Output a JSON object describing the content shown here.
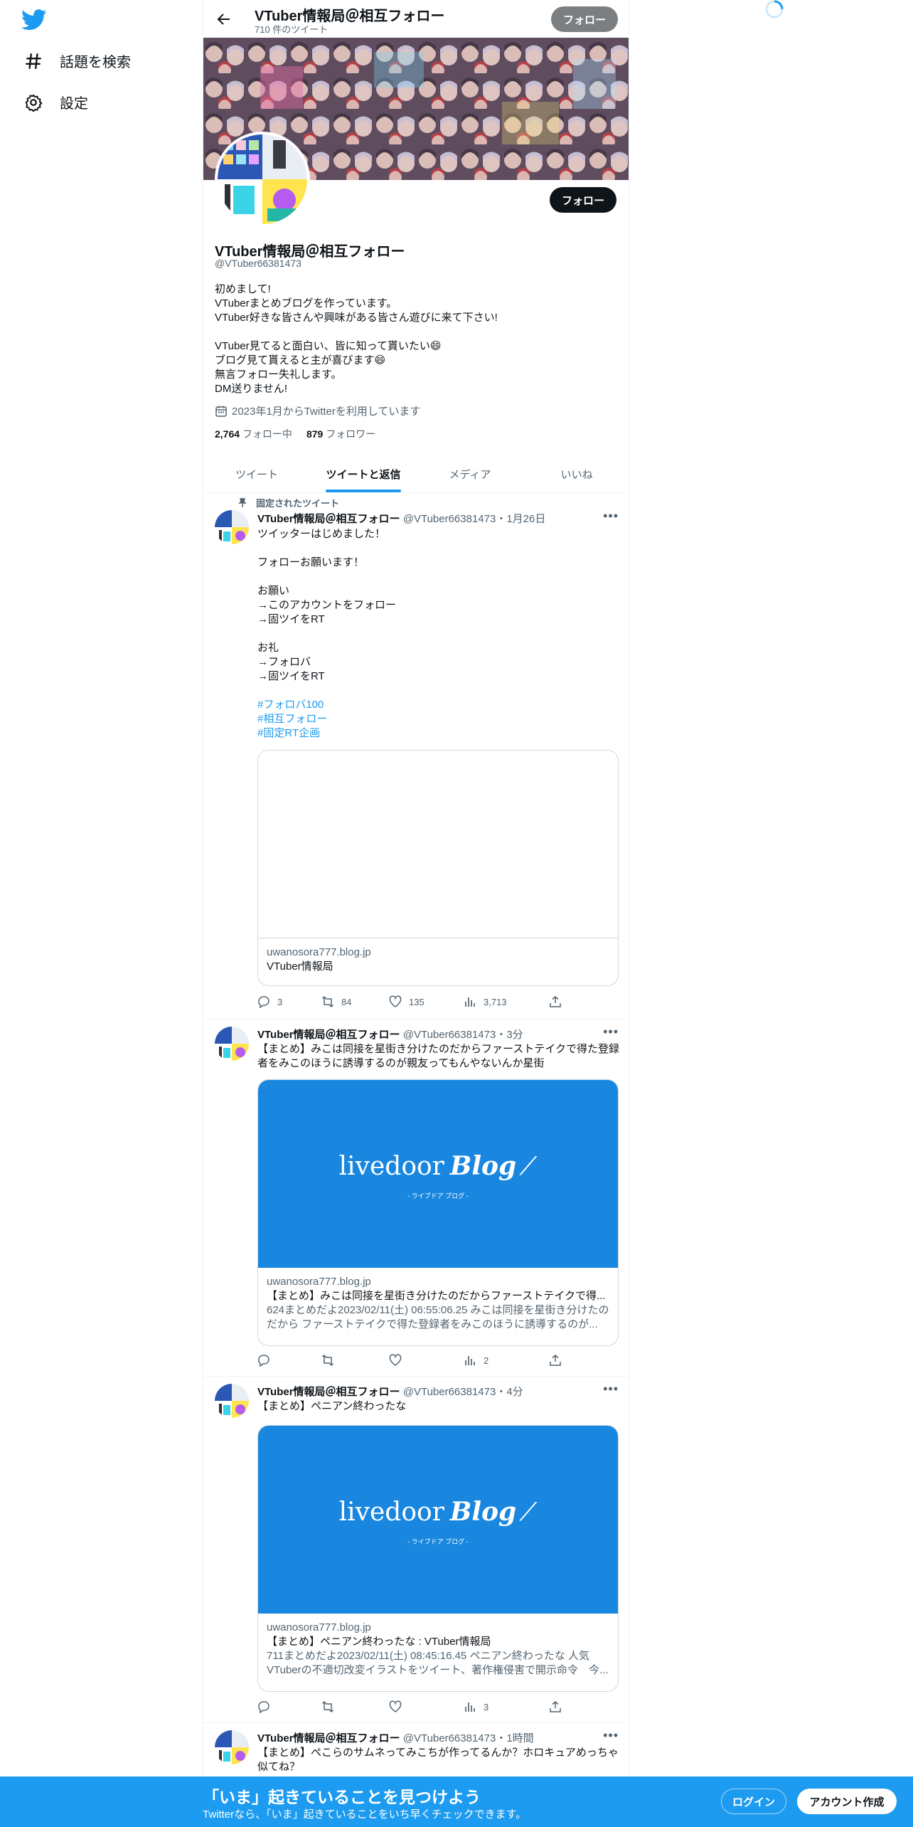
{
  "sidebar": {
    "logo": "twitter-bird",
    "items": [
      {
        "label": "話題を検索",
        "icon": "hashtag-icon"
      },
      {
        "label": "設定",
        "icon": "gear-icon"
      }
    ]
  },
  "header": {
    "name": "VTuber情報局＠相互フォロー",
    "tweet_count": "710 件のツイート",
    "follow_label": "フォロー"
  },
  "profile": {
    "name": "VTuber情報局＠相互フォロー",
    "handle": "@VTuber66381473",
    "follow_label": "フォロー",
    "bio": "初めまして!\nVTuberまとめブログを作っています。\nVTuber好きな皆さんや興味がある皆さん遊びに来て下さい!\n\nVTuber見てると面白い、皆に知って貰いたい😄\nブログ見て貰えると主が喜びます😄\n無言フォロー失礼します。\nDM送りません!",
    "joined": "2023年1月からTwitterを利用しています",
    "following_count": "2,764",
    "following_label": "フォロー中",
    "followers_count": "879",
    "followers_label": "フォロワー"
  },
  "tabs": [
    {
      "label": "ツイート",
      "active": false
    },
    {
      "label": "ツイートと返信",
      "active": true
    },
    {
      "label": "メディア",
      "active": false
    },
    {
      "label": "いいね",
      "active": false
    }
  ],
  "pinned_label": "固定されたツイート",
  "tweets": [
    {
      "name": "VTuber情報局＠相互フォロー",
      "handle_time": "@VTuber66381473・1月26日",
      "text": "ツイッターはじめました！\n\nフォローお願います！\n\nお願い\n→このアカウントをフォロー\n→固ツイをRT\n\nお礼\n→フォロバ\n→固ツイをRT",
      "hashtags": [
        "#フォロバ100",
        "#相互フォロー",
        "#固定RT企画"
      ],
      "card_domain": "uwanosora777.blog.jp",
      "card_title": "VTuber情報局",
      "replies": "3",
      "retweets": "84",
      "likes": "135",
      "views": "3,713"
    },
    {
      "name": "VTuber情報局＠相互フォロー",
      "handle_time": "@VTuber66381473・3分",
      "text": "【まとめ】みこは同接を星街き分けたのだからファーストテイクで得た登録者をみこのほうに誘導するのが親友ってもんやないんか星街",
      "card_domain": "uwanosora777.blog.jp",
      "card_title": "【まとめ】みこは同接を星街き分けたのだからファーストテイクで得...",
      "card_desc": "624まとめだよ2023/02/11(土) 06:55:06.25 みこは同接を星街き分けたのだから ファーストテイクで得た登録者をみこのほうに誘導するのが...",
      "replies": "",
      "retweets": "",
      "likes": "",
      "views": "2"
    },
    {
      "name": "VTuber情報局＠相互フォロー",
      "handle_time": "@VTuber66381473・4分",
      "text": "【まとめ】ペニアン終わったな",
      "card_domain": "uwanosora777.blog.jp",
      "card_title": "【まとめ】ペニアン終わったな : VTuber情報局",
      "card_desc": "711まとめだよ2023/02/11(土) 08:45:16.45 ペニアン終わったな 人気VTuberの不適切改変イラストをツイート、著作権侵害で開示命令　今...",
      "replies": "",
      "retweets": "",
      "likes": "",
      "views": "3"
    },
    {
      "name": "VTuber情報局＠相互フォロー",
      "handle_time": "@VTuber66381473・1時間",
      "text": "【まとめ】ぺこらのサムネってみこちが作ってるんか？ホロキュアめっちゃ似てね？"
    }
  ],
  "livedoor": {
    "brand": "livedoor",
    "blog": "Blog",
    "sub": "- ライブドア ブログ -"
  },
  "bottom_bar": {
    "title": "「いま」起きていることを見つけよう",
    "subtitle": "Twitterなら、「いま」起きていることをいち早くチェックできます。",
    "login": "ログイン",
    "signup": "アカウント作成"
  },
  "colors": {
    "accent": "#1d9bf0",
    "text": "#0f1419",
    "muted": "#536471"
  }
}
